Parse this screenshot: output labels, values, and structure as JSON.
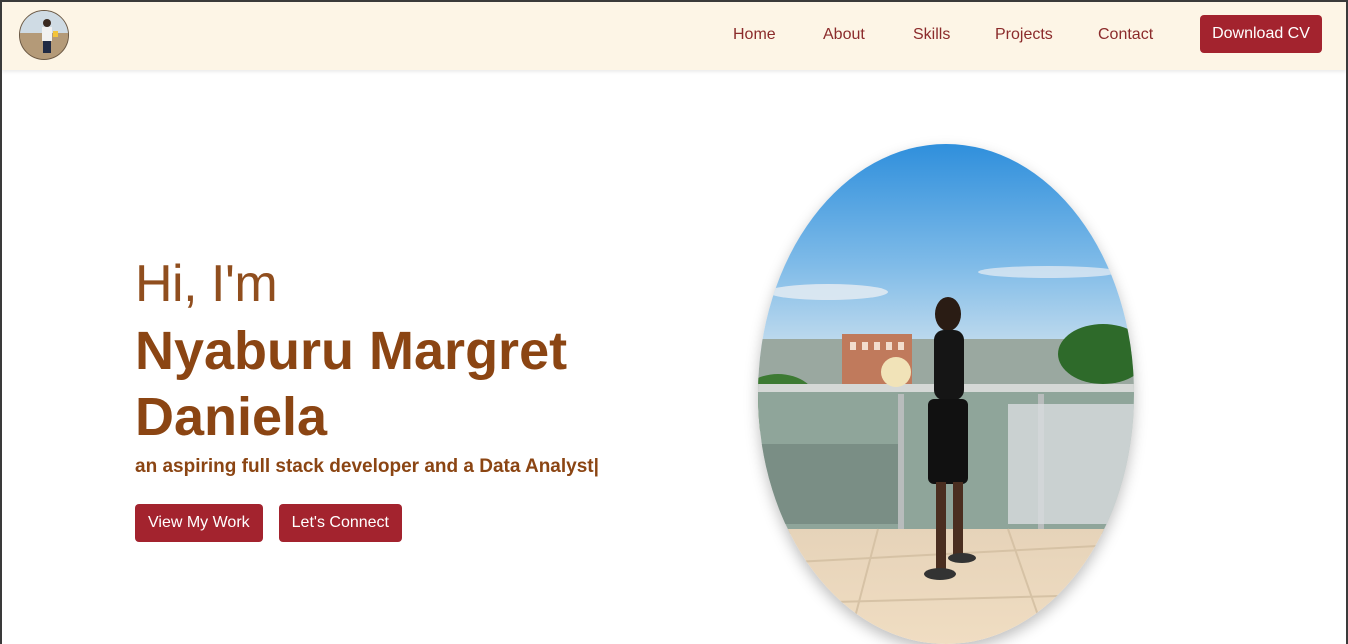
{
  "nav": {
    "logo_alt": "profile-avatar",
    "links": [
      "Home",
      "About",
      "Skills",
      "Projects",
      "Contact"
    ],
    "cv_button": "Download CV"
  },
  "hero": {
    "greeting": "Hi, I'm",
    "name": "Nyaburu Margret Daniela",
    "tagline": "an aspiring full stack developer and a Data Analyst|",
    "primary_button": "View My Work",
    "secondary_button": "Let's Connect"
  },
  "colors": {
    "navbar_bg": "#fdf5e6",
    "nav_link": "#8b2b2b",
    "accent_button": "#a3232e",
    "heading_brown": "#8b4513"
  },
  "icons": {
    "logo": "avatar-image",
    "portrait": "portrait-photo"
  }
}
